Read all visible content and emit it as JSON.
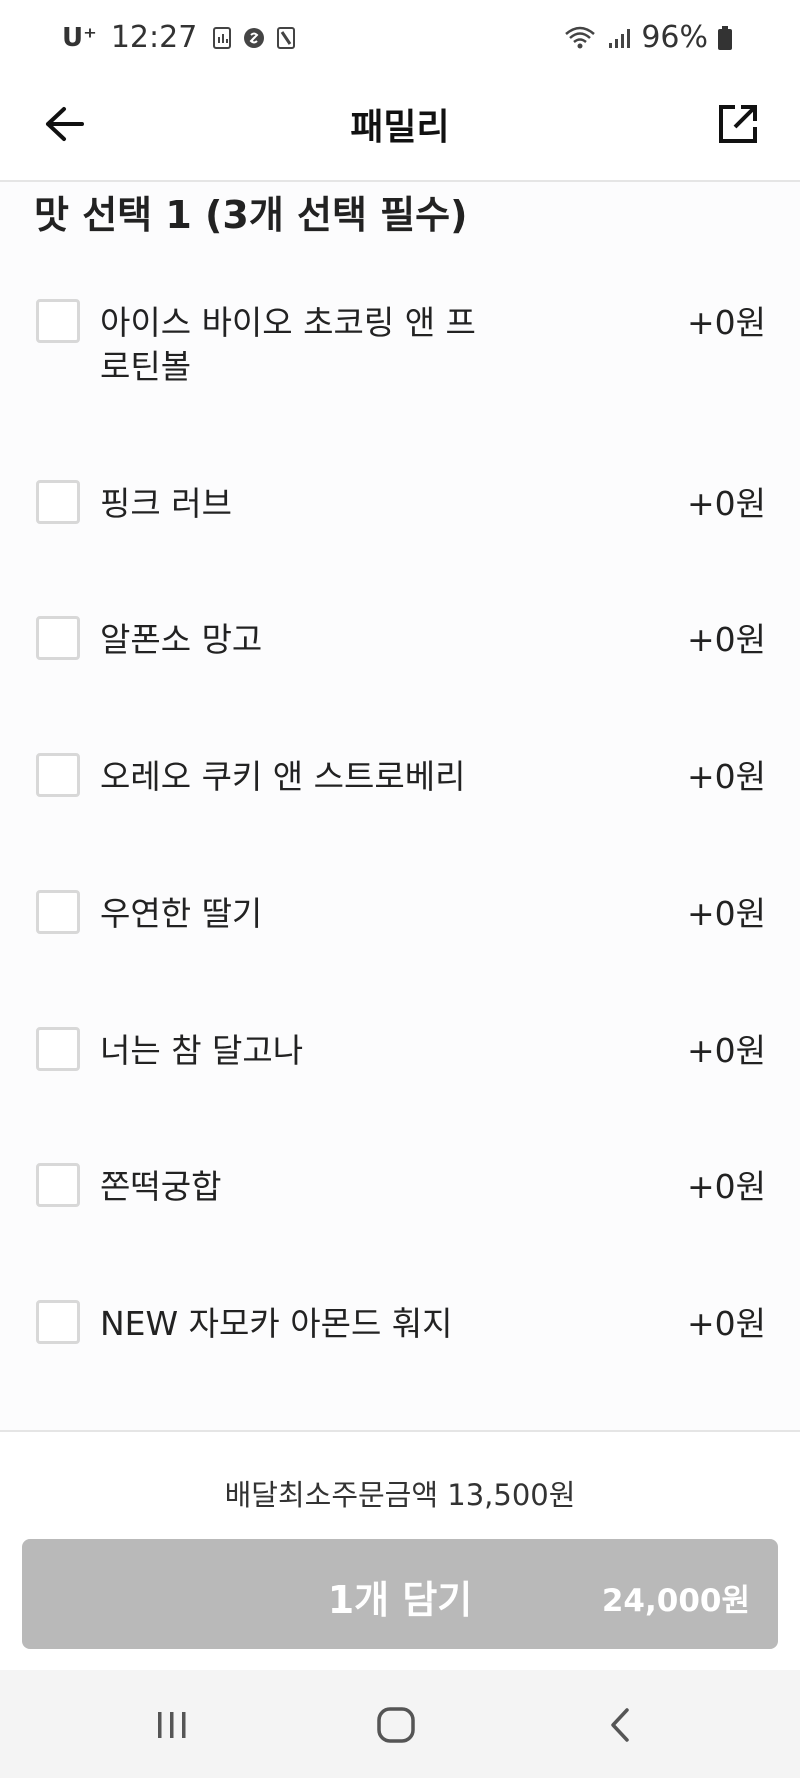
{
  "status_bar": {
    "carrier": "U⁺",
    "time": "12:27",
    "battery": "96%",
    "icons_left": [
      "gallery-icon",
      "shazam-icon",
      "device-icon"
    ],
    "icons_right": [
      "wifi-icon",
      "signal-icon",
      "battery-icon"
    ]
  },
  "header": {
    "title": "패밀리"
  },
  "section": {
    "title": "맛 선택 1 (3개 선택 필수)"
  },
  "options": [
    {
      "label": "아이스 바이오 초코링 앤 프로틴볼",
      "price": "+0원",
      "checked": false
    },
    {
      "label": "핑크 러브",
      "price": "+0원",
      "checked": false
    },
    {
      "label": "알폰소 망고",
      "price": "+0원",
      "checked": false
    },
    {
      "label": "오레오 쿠키 앤 스트로베리",
      "price": "+0원",
      "checked": false
    },
    {
      "label": "우연한 딸기",
      "price": "+0원",
      "checked": false
    },
    {
      "label": "너는 참 달고나",
      "price": "+0원",
      "checked": false
    },
    {
      "label": "쫀떡궁합",
      "price": "+0원",
      "checked": false
    },
    {
      "label": "NEW 자모카 아몬드 훠지",
      "price": "+0원",
      "checked": false
    }
  ],
  "footer": {
    "min_order": "배달최소주문금액 13,500원",
    "add_label": "1개 담기",
    "add_price": "24,000원"
  },
  "colors": {
    "button_disabled": "#b9b9b9",
    "checkbox_border": "#d8d8d8"
  }
}
